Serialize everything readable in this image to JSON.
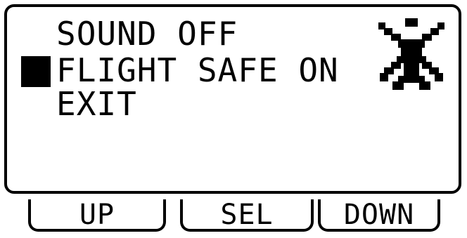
{
  "menu": {
    "items": [
      {
        "label": "SOUND OFF"
      },
      {
        "label": "FLIGHT SAFE ON"
      },
      {
        "label": "EXIT"
      }
    ],
    "selected_index": 1
  },
  "status_icon": "bird-of-prey-icon",
  "softkeys": {
    "up": "UP",
    "select": "SEL",
    "down": "DOWN"
  },
  "colors": {
    "foreground": "#000000",
    "background": "#ffffff"
  }
}
